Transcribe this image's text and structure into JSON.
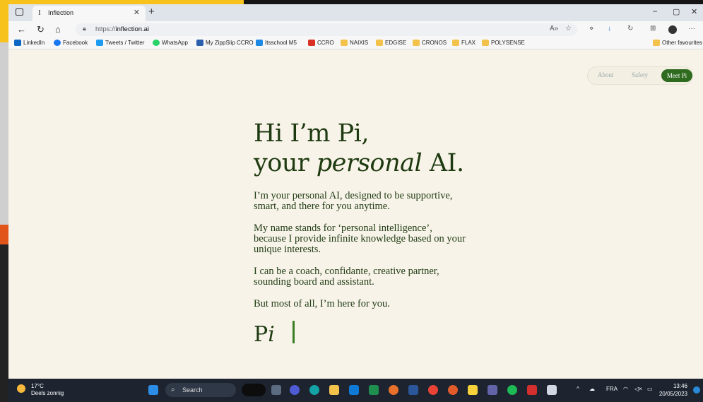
{
  "browser": {
    "tab_title": "Inflection",
    "tab_favicon": "I",
    "url_protocol": "https://",
    "url_host": "inflection.ai",
    "window_controls": [
      "–",
      "▢",
      "✕"
    ]
  },
  "bookmarks": [
    {
      "label": "LinkedIn",
      "icon": "linkedin-icon",
      "color": "#0a66c2"
    },
    {
      "label": "Facebook",
      "icon": "facebook-icon",
      "color": "#1877f2"
    },
    {
      "label": "Tweets / Twitter",
      "icon": "twitter-icon",
      "color": "#1d9bf0"
    },
    {
      "label": "WhatsApp",
      "icon": "whatsapp-icon",
      "color": "#25d366"
    },
    {
      "label": "My ZippSlip CCRO",
      "icon": "zippslip-icon",
      "color": "#2b5fae"
    },
    {
      "label": "Itsschool M5",
      "icon": "itsschool-icon",
      "color": "#1e88e5"
    },
    {
      "label": "CCRO",
      "icon": "gmail-icon",
      "color": "#d93025"
    },
    {
      "label": "NAIXIS",
      "icon": "folder-icon",
      "color": "#f3c24b"
    },
    {
      "label": "EDGISE",
      "icon": "folder-icon",
      "color": "#f3c24b"
    },
    {
      "label": "CRONOS",
      "icon": "folder-icon",
      "color": "#f3c24b"
    },
    {
      "label": "FLAX",
      "icon": "folder-icon",
      "color": "#f3c24b"
    },
    {
      "label": "POLYSENSE",
      "icon": "folder-icon",
      "color": "#f3c24b"
    }
  ],
  "other_favourites": "Other favourites",
  "site_nav": {
    "about": "About",
    "safety": "Safety",
    "meet": "Meet Pi",
    "accent": "#2f6b1f"
  },
  "hero": {
    "line1": "Hi I’m Pi,",
    "line2_pre": "your ",
    "line2_em": "personal",
    "line2_post": " AI.",
    "p1": "I’m your personal AI, designed to be supportive, smart, and there for you anytime.",
    "p2": "My name stands for ‘personal intelligence’, because I provide infinite knowledge based on your unique interests.",
    "p3": "I can be a coach, confidante, creative partner, sounding board and assistant.",
    "p4": "But most of all, I’m here for you.",
    "signature_p": "P",
    "signature_i": "i"
  },
  "taskbar": {
    "temp": "17°C",
    "weather": "Deels zonnig",
    "search": "Search",
    "lang": "FRA",
    "time": "13:46",
    "date": "20/05/2023"
  }
}
